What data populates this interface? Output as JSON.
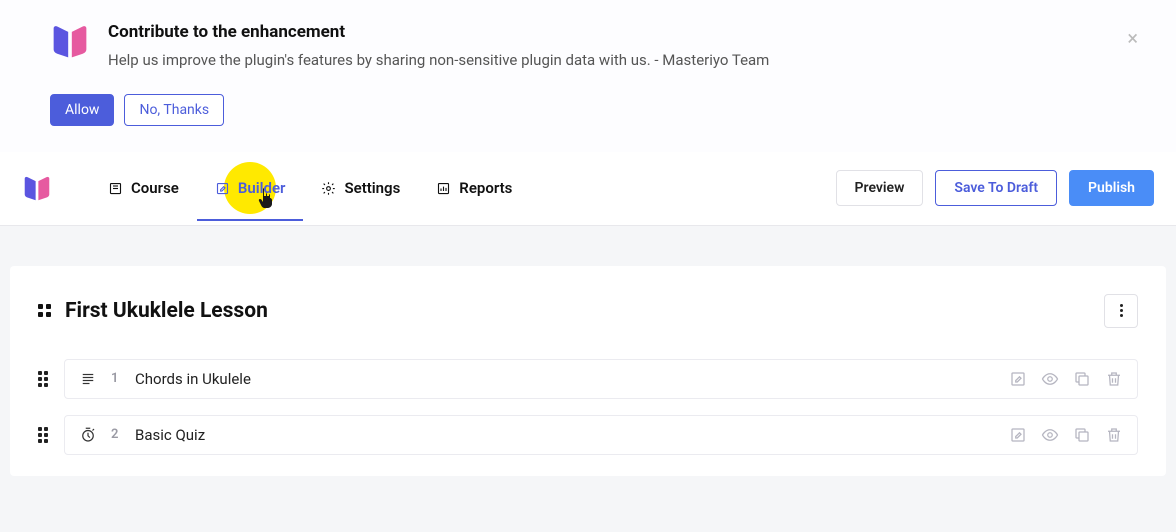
{
  "notice": {
    "title": "Contribute to the enhancement",
    "body": "Help us improve the plugin's features by sharing non-sensitive plugin data with us. - Masteriyo Team",
    "allow_label": "Allow",
    "deny_label": "No, Thanks"
  },
  "tabs": {
    "course": "Course",
    "builder": "Builder",
    "settings": "Settings",
    "reports": "Reports"
  },
  "nav_buttons": {
    "preview": "Preview",
    "draft": "Save To Draft",
    "publish": "Publish"
  },
  "section": {
    "title": "First Ukuklele Lesson",
    "items": [
      {
        "index": "1",
        "name": "Chords in Ukulele",
        "type": "lesson"
      },
      {
        "index": "2",
        "name": "Basic Quiz",
        "type": "quiz"
      }
    ]
  }
}
